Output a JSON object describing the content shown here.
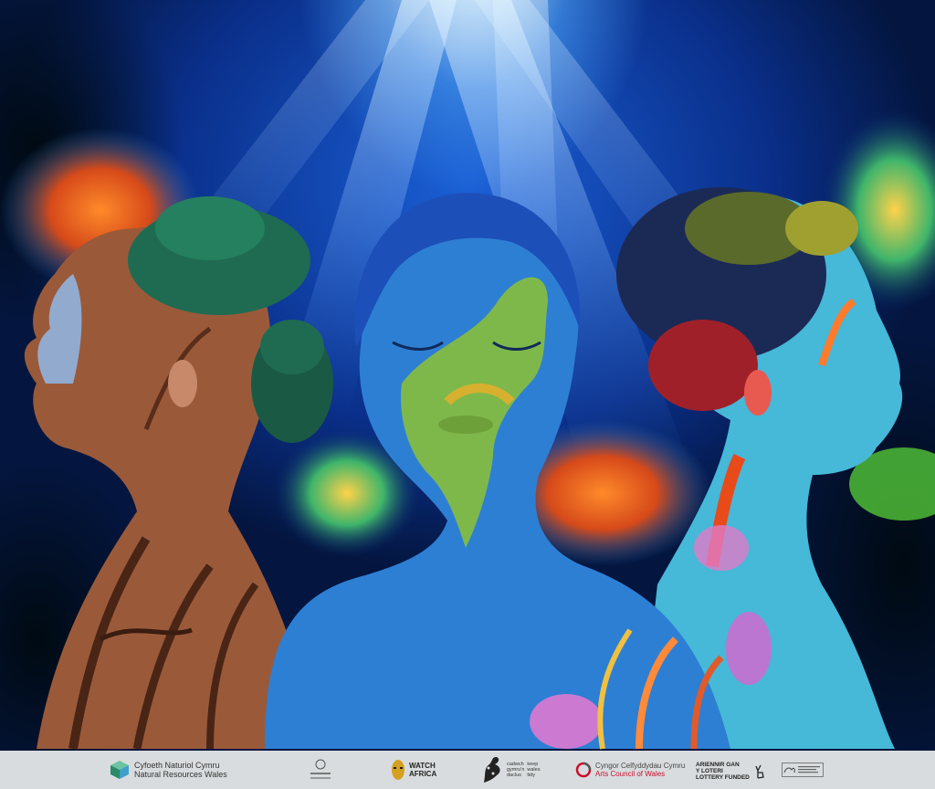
{
  "logos": {
    "nrw": {
      "line1": "Cyfoeth Naturiol Cymru",
      "line2": "Natural Resources Wales",
      "icon": "nrw-cube-icon"
    },
    "watch_africa": {
      "line1": "WATCH",
      "line2": "AFRICA",
      "icon": "mask-icon"
    },
    "keep_wales_tidy": {
      "line1": "cadwch",
      "line2": "gymru'n",
      "line3": "daclus",
      "line4": "keep",
      "line5": "wales",
      "line6": "tidy"
    },
    "arts_council": {
      "line1": "Cyngor Celfyddydau Cymru",
      "line2": "Arts Council of Wales",
      "accent": "#c8102e"
    },
    "lottery": {
      "line1": "ARIENNIR GAN",
      "line2": "Y LOTERI",
      "line3": "LOTTERY FUNDED",
      "icon": "crossed-fingers-icon"
    }
  },
  "colors": {
    "ocean_deep": "#031230",
    "ocean_mid": "#1a5fd6",
    "skin_blue": "#3a86d8",
    "skin_brown": "#9a5a3a",
    "hair_green": "#1f6b52",
    "logo_bar": "#d9dcde"
  }
}
